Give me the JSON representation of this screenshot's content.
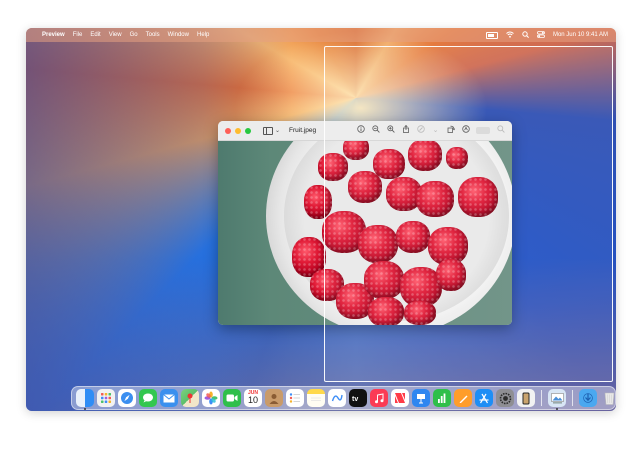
{
  "menubar": {
    "apple_glyph": "",
    "app_name": "Preview",
    "menus": [
      "File",
      "Edit",
      "View",
      "Go",
      "Tools",
      "Window",
      "Help"
    ],
    "clock": "Mon Jun 10  9:41 AM"
  },
  "window": {
    "filename": "Fruit.jpeg",
    "sidebar_chevron": "⌄"
  },
  "dock": {
    "calendar_month": "JUN",
    "calendar_day": "10",
    "apps": [
      {
        "name": "finder",
        "color": "#2f8df5"
      },
      {
        "name": "launchpad",
        "color": "#f2f2f2"
      },
      {
        "name": "safari",
        "color": "#3b8ff0"
      },
      {
        "name": "messages",
        "color": "#33c74f"
      },
      {
        "name": "mail",
        "color": "#3b90ee"
      },
      {
        "name": "maps",
        "color": "#5cbf6a"
      },
      {
        "name": "photos",
        "color": "#ffffff"
      },
      {
        "name": "facetime",
        "color": "#2fbf4a"
      },
      {
        "name": "calendar",
        "color": "#ffffff"
      },
      {
        "name": "contacts",
        "color": "#c99b6a"
      },
      {
        "name": "reminders",
        "color": "#ffffff"
      },
      {
        "name": "notes",
        "color": "#ffd94a"
      },
      {
        "name": "freeform",
        "color": "#ffffff"
      },
      {
        "name": "tv",
        "color": "#111111"
      },
      {
        "name": "music",
        "color": "#fb3b55"
      },
      {
        "name": "news",
        "color": "#ff3b47"
      },
      {
        "name": "keynote",
        "color": "#2f86f0"
      },
      {
        "name": "numbers",
        "color": "#2fbf4a"
      },
      {
        "name": "pages",
        "color": "#ff9d2a"
      },
      {
        "name": "app-store",
        "color": "#1e8ef5"
      },
      {
        "name": "system-settings",
        "color": "#8e8e93"
      },
      {
        "name": "iphone-mirroring",
        "color": "#2b2b2b"
      },
      {
        "name": "preview",
        "color": "#d8e6f5"
      },
      {
        "name": "downloads-folder",
        "color": "#4aa8f0"
      },
      {
        "name": "trash",
        "color": "#dcdcdc"
      }
    ]
  }
}
